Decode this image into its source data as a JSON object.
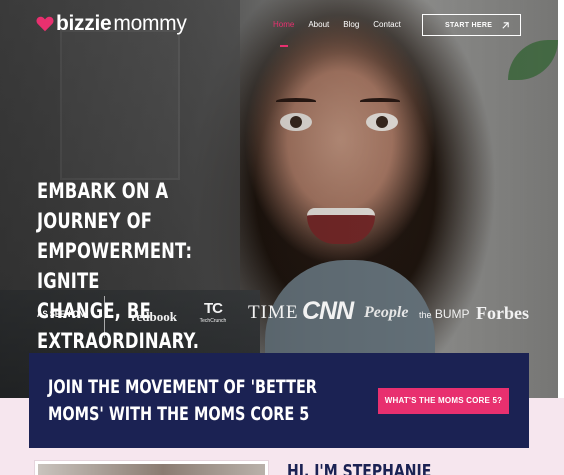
{
  "brand": {
    "logo_bold": "bizzie",
    "logo_light": "mommy",
    "accent": "#e8306f",
    "navy": "#1b2253"
  },
  "nav": {
    "items": [
      {
        "label": "Home",
        "active": true
      },
      {
        "label": "About",
        "active": false
      },
      {
        "label": "Blog",
        "active": false
      },
      {
        "label": "Contact",
        "active": false
      }
    ],
    "start_label": "START HERE",
    "start_icon": "arrow-up-right-icon"
  },
  "hero": {
    "headline_lines": [
      "EMBARK ON A JOURNEY OF",
      "EMPOWERMENT: IGNITE",
      "CHANGE, BE EXTRAORDINARY."
    ]
  },
  "press": {
    "label": "AS SEEN ON",
    "logos": {
      "redbook": "redbook",
      "techcrunch_mark": "TC",
      "techcrunch_name": "TechCrunch",
      "time": "TIME",
      "cnn": "CNN",
      "people": "People",
      "bump_the": "the",
      "bump_name": "BUMP",
      "forbes": "Forbes"
    }
  },
  "cta": {
    "title_lines": [
      "JOIN THE MOVEMENT OF 'BETTER",
      "MOMS' WITH THE MOMS CORE 5"
    ],
    "button_label": "WHAT'S THE MOMS CORE 5?"
  },
  "about": {
    "heading": "HI, I'M STEPHANIE"
  }
}
